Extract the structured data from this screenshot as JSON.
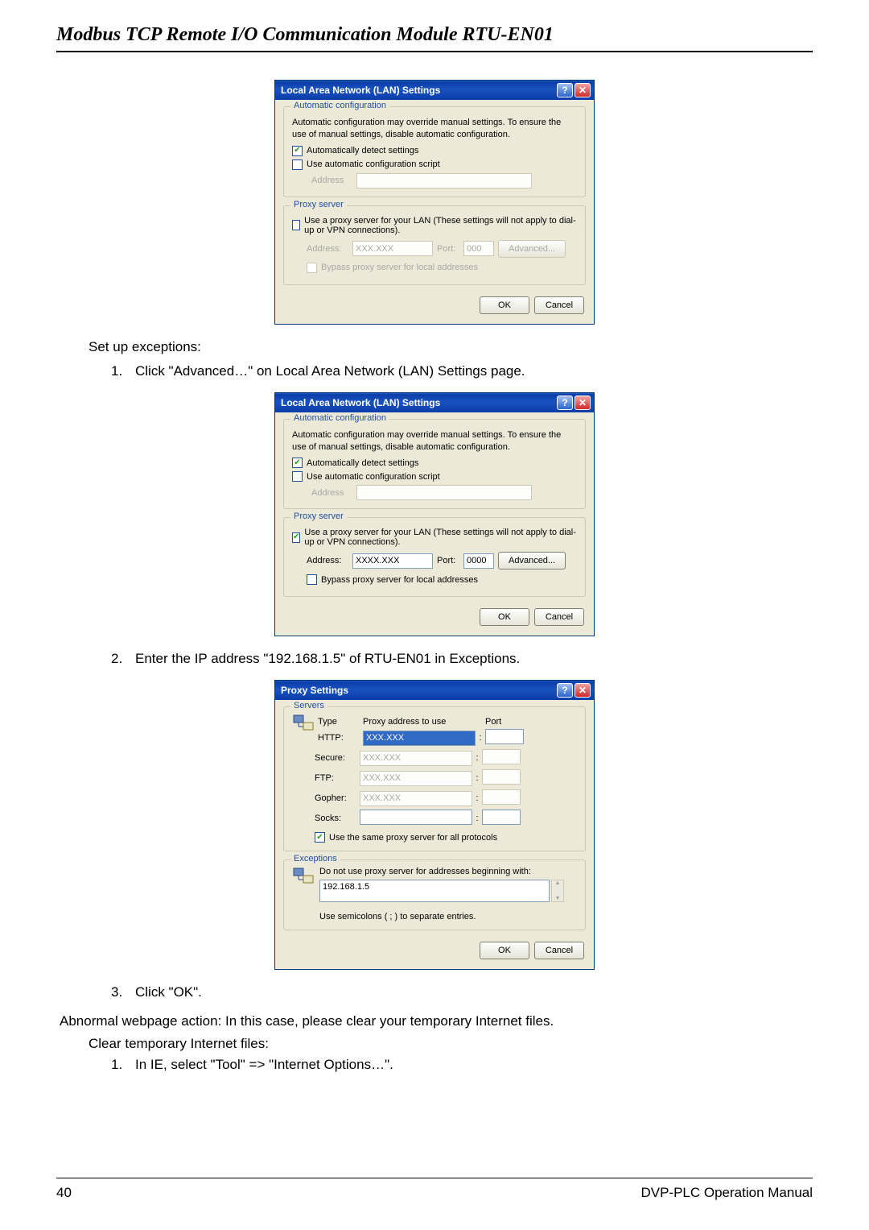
{
  "doc_title": "Modbus TCP Remote I/O Communication Module RTU-EN01",
  "section_exceptions": "Set up exceptions:",
  "step1": "Click \"Advanced…\" on Local Area Network (LAN) Settings page.",
  "step2": "Enter the IP address \"192.168.1.5\" of RTU-EN01 in Exceptions.",
  "step3": "Click \"OK\".",
  "abnormal": "Abnormal webpage action: In this case, please clear your temporary Internet files.",
  "clear_temp": "Clear temporary Internet files:",
  "clear_step1": "In IE, select \"Tool\" => \"Internet Options…\".",
  "page_num": "40",
  "footer_right": "DVP-PLC Operation Manual",
  "lan_dialog": {
    "title": "Local Area Network (LAN) Settings",
    "grp_auto": "Automatic configuration",
    "auto_desc": "Automatic configuration may override manual settings.  To ensure the use of manual settings, disable automatic configuration.",
    "chk_autodetect": "Automatically detect settings",
    "chk_script": "Use automatic configuration script",
    "address_lbl": "Address",
    "grp_proxy": "Proxy server",
    "proxy_desc": "Use a proxy server for your LAN (These settings will not apply to dial-up or VPN connections).",
    "address2_lbl": "Address:",
    "port_lbl": "Port:",
    "addr_val_dis": "XXX.XXX",
    "port_val_dis": "000",
    "addr_val": "XXXX.XXX",
    "port_val": "0000",
    "btn_adv": "Advanced...",
    "chk_bypass": "Bypass proxy server for local addresses",
    "btn_ok": "OK",
    "btn_cancel": "Cancel"
  },
  "proxy_dialog": {
    "title": "Proxy Settings",
    "grp_servers": "Servers",
    "hdr_type": "Type",
    "hdr_addr": "Proxy address to use",
    "hdr_port": "Port",
    "rows": [
      {
        "label": "HTTP:",
        "addr": "XXX.XXX",
        "port": "",
        "active": true
      },
      {
        "label": "Secure:",
        "addr": "XXX.XXX",
        "port": "",
        "active": false
      },
      {
        "label": "FTP:",
        "addr": "XXX.XXX",
        "port": "",
        "active": false
      },
      {
        "label": "Gopher:",
        "addr": "XXX.XXX",
        "port": "",
        "active": false
      },
      {
        "label": "Socks:",
        "addr": "",
        "port": "",
        "active": false
      }
    ],
    "chk_same": "Use the same proxy server for all protocols",
    "grp_exc": "Exceptions",
    "exc_desc": "Do not use proxy server for addresses beginning with:",
    "exc_val": "192.168.1.5",
    "exc_hint": "Use semicolons ( ; ) to separate entries.",
    "btn_ok": "OK",
    "btn_cancel": "Cancel"
  }
}
